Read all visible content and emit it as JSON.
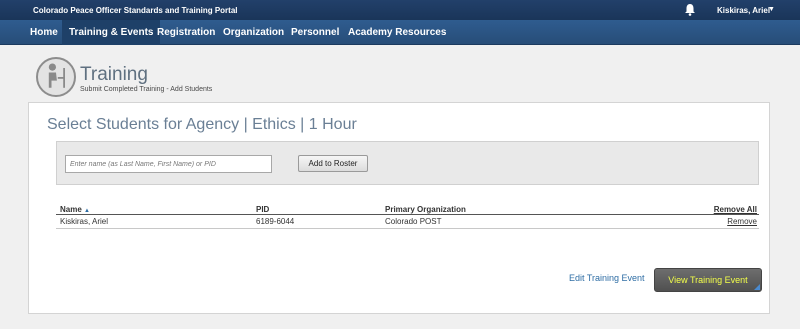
{
  "topbar": {
    "portal_title": "Colorado Peace Officer Standards and Training Portal",
    "user_name": "Kiskiras, Ariel",
    "caret": "▼"
  },
  "nav": {
    "items": [
      {
        "label": "Home"
      },
      {
        "label": "Training & Events"
      },
      {
        "label": "Registration"
      },
      {
        "label": "Organization"
      },
      {
        "label": "Personnel"
      },
      {
        "label": "Academy Resources"
      }
    ],
    "active": "Training & Events"
  },
  "header": {
    "title": "Training",
    "subtitle": "Submit Completed Training - Add Students"
  },
  "main": {
    "section_title": "Select Students for Agency | Ethics | 1 Hour",
    "search": {
      "placeholder": "Enter name (as Last Name, First Name) or PID",
      "value": ""
    },
    "add_button": "Add to Roster",
    "table": {
      "columns": [
        "Name",
        "PID",
        "Primary Organization"
      ],
      "sort_indicator": "▲",
      "remove_all": "Remove All",
      "rows": [
        {
          "name": "Kiskiras, Ariel",
          "pid": "6189-6044",
          "org": "Colorado POST",
          "action": "Remove"
        }
      ]
    },
    "edit_link": "Edit Training Event",
    "view_button": "View Training Event"
  },
  "colors": {
    "topbar": "#1a3559",
    "navbar": "#2b5585",
    "link": "#2e6da4",
    "view_button_text": "#f3ff4a"
  }
}
